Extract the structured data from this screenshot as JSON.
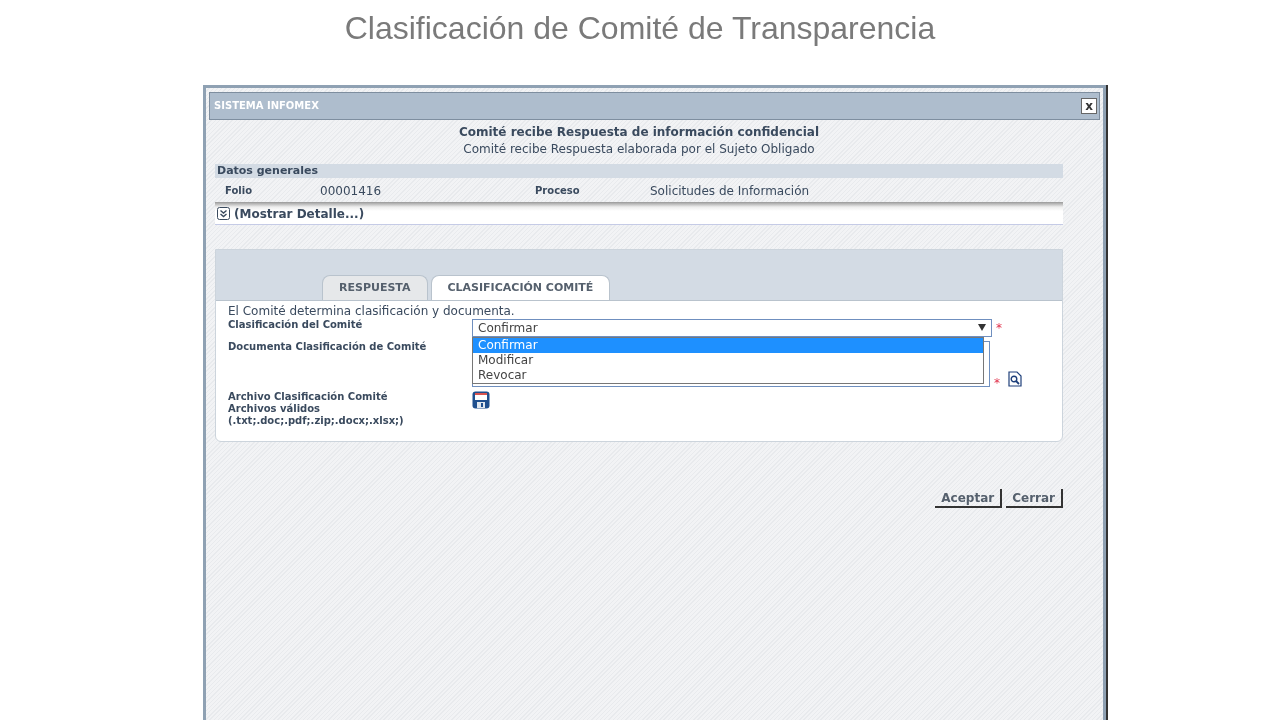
{
  "slide_title": "Clasificación de Comité de Transparencia",
  "window": {
    "title": "SISTEMA INFOMEX",
    "close": "x"
  },
  "header": {
    "title": "Comité recibe Respuesta de información confidencial",
    "subtitle": "Comité recibe Respuesta elaborada por el Sujeto Obligado"
  },
  "general": {
    "heading": "Datos generales",
    "fields": [
      {
        "label": "Folio",
        "value": "00001416"
      },
      {
        "label": "Proceso",
        "value": "Solicitudes de Información"
      }
    ],
    "toggle": "(Mostrar Detalle...)",
    "expanded": false
  },
  "tabs": [
    {
      "label": "RESPUESTA",
      "selected": false
    },
    {
      "label": "CLASIFICACIÓN COMITÉ",
      "selected": true
    }
  ],
  "form": {
    "intro": "El Comité determina clasificación y documenta.",
    "classification": {
      "label": "Clasificación del Comité",
      "value": "Confirmar",
      "required_mark": "*",
      "expanded": true,
      "options": [
        {
          "label": "Confirmar",
          "selected": true
        },
        {
          "label": "Modificar",
          "selected": false
        },
        {
          "label": "Revocar",
          "selected": false
        }
      ]
    },
    "document": {
      "label": "Documenta Clasificación de Comité",
      "required_mark": "*"
    },
    "file": {
      "label": "Archivo Clasificación Comité",
      "hint": "Archivos válidos",
      "extensions": "(.txt;.doc;.pdf;.zip;.docx;.xlsx;)"
    }
  },
  "buttons": [
    "Aceptar",
    "Cerrar"
  ]
}
